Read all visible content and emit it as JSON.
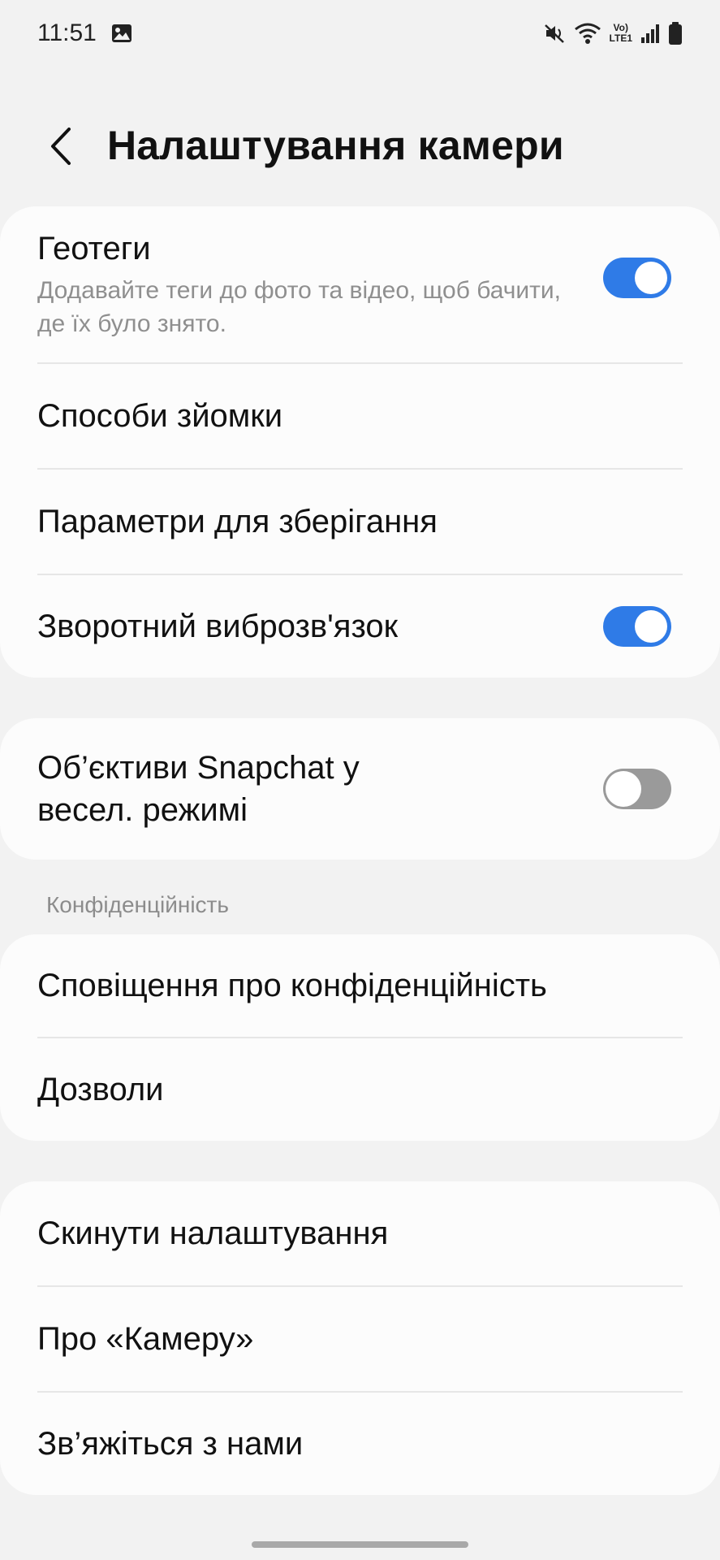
{
  "status_bar": {
    "time": "11:51",
    "icons": [
      "gallery-icon",
      "mute-icon",
      "wifi-icon",
      "volte-lte-icon",
      "signal-icon",
      "battery-icon"
    ],
    "network_top": "Vo)",
    "network_bottom": "LTE1"
  },
  "header": {
    "title": "Налаштування камери",
    "back_icon": "chevron-left-icon"
  },
  "card_general": {
    "geotags": {
      "label": "Геотеги",
      "description": "Додавайте теги до фото та відео, щоб бачити, де їх було знято.",
      "enabled": true
    },
    "shooting_methods": {
      "label": "Способи зйомки"
    },
    "storage_options": {
      "label": "Параметри для зберігання"
    },
    "vibration_feedback": {
      "label": "Зворотний виброзв'язок",
      "enabled": true
    }
  },
  "card_snapchat": {
    "snapchat_lenses": {
      "label_line1": "Об’єктиви Snapchat у",
      "label_line2": "весел. режимі",
      "enabled": false
    }
  },
  "privacy_section": {
    "header": "Конфіденційність",
    "privacy_notice": {
      "label": "Сповіщення про конфіденційність"
    },
    "permissions": {
      "label": "Дозволи"
    }
  },
  "card_about": {
    "reset_settings": {
      "label": "Скинути налаштування"
    },
    "about_camera": {
      "label": "Про «Камеру»"
    },
    "contact_us": {
      "label": "Зв’яжіться з нами"
    }
  },
  "colors": {
    "accent": "#2f7be7",
    "background": "#f2f2f2",
    "card": "#fcfcfc",
    "secondary_text": "#8f8f8f"
  }
}
